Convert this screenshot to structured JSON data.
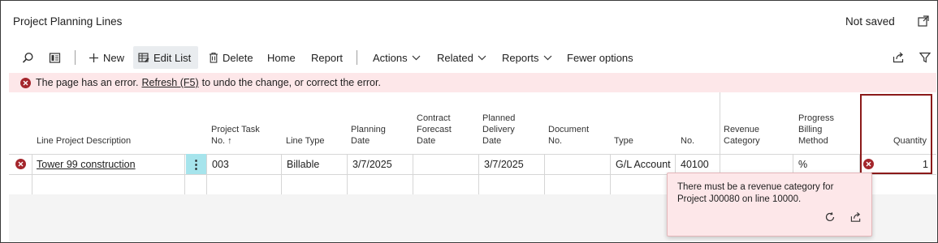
{
  "page": {
    "title": "Project Planning Lines",
    "save_status": "Not saved"
  },
  "toolbar": {
    "new_label": "New",
    "edit_list_label": "Edit List",
    "delete_label": "Delete",
    "home_label": "Home",
    "report_label": "Report",
    "actions_label": "Actions",
    "related_label": "Related",
    "reports_label": "Reports",
    "fewer_options_label": "Fewer options",
    "icons": [
      "search-icon",
      "filter-pane-icon",
      "plus-icon",
      "edit-list-icon",
      "trash-icon",
      "chevron-down-icon",
      "share-icon",
      "filter-icon"
    ]
  },
  "error_banner": {
    "before": "The page has an error.",
    "link": "Refresh (F5)",
    "after": "to undo the change, or correct the error."
  },
  "table": {
    "columns": [
      "Line Project Description",
      "Project Task\nNo. ↑",
      "Line Type",
      "Planning\nDate",
      "Contract\nForecast\nDate",
      "Planned\nDelivery\nDate",
      "Document\nNo.",
      "Type",
      "No.",
      "Revenue\nCategory",
      "Progress\nBilling\nMethod",
      "Quantity"
    ],
    "row": {
      "description": "Tower 99 construction",
      "task_no": "003",
      "line_type": "Billable",
      "planning_date": "3/7/2025",
      "contract_forecast_date": "",
      "planned_delivery_date": "3/7/2025",
      "document_no": "",
      "type": "G/L Account",
      "no": "40100",
      "revenue_category": "",
      "progress_billing_method": "%",
      "quantity": "1"
    },
    "menu_glyph": "⋮"
  },
  "tooltip": {
    "message": "There must be a revenue category for Project J00080 on line 10000."
  },
  "colors": {
    "error": "#a4262c",
    "error_bg": "#fde7e9",
    "highlight_border": "#8b1a1a",
    "menu_cell": "#a6e4ec"
  }
}
